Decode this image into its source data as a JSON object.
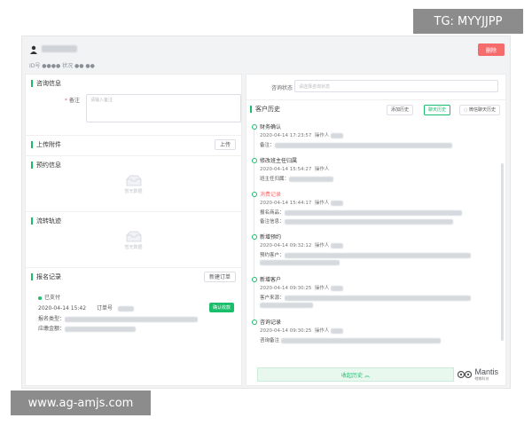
{
  "overlay_top": "TG: MYYJJPP",
  "overlay_bottom": "www.ag-amjs.com",
  "top": {
    "meta": "ID号 ●●●● 状况 ●● ●●",
    "action_button": "删除"
  },
  "left": {
    "consult_title": "咨询信息",
    "remark_label": "备注",
    "remark_placeholder": "请输入备注",
    "upload_title": "上传附件",
    "upload_button": "上传",
    "appointment_title": "预约信息",
    "empty_text": "暂无数据",
    "trail_title": "流转轨迹",
    "signup_title": "报名记录",
    "new_order_button": "新建订单",
    "order": {
      "status": "已支付",
      "time": "2020-04-14 15:42",
      "order_no_label": "订单号",
      "tag": "确认收款",
      "type_label": "报名类型：",
      "amount_label": "应缴金额："
    }
  },
  "right": {
    "search_label": "咨询状态",
    "search_placeholder": "请选择咨询状态",
    "history_title": "客户历史",
    "btn_follow": "添加历史",
    "btn_chat": "聊天历史",
    "btn_wechat": "微信聊天历史",
    "items": [
      {
        "title": "财务确认",
        "time": "2020-04-14 17:23:57",
        "op": "操作人",
        "detail_label": "备注："
      },
      {
        "title": "修改班主任归属",
        "time": "2020-04-14 15:54:27",
        "op": "操作人",
        "detail_label": "班主任归属："
      },
      {
        "title": "消费记录",
        "time": "2020-04-14 15:44:17",
        "op": "操作人",
        "detail_label": "报名商品：",
        "detail_label2": "备注信息："
      },
      {
        "title": "新增预约",
        "time": "2020-04-14 09:32:12",
        "op": "操作人",
        "detail_label": "预约客户："
      },
      {
        "title": "新增客户",
        "time": "2020-04-14 09:30:25",
        "op": "操作人",
        "detail_label": "客户来源："
      },
      {
        "title": "咨询记录",
        "time": "2020-04-14 09:30:25",
        "op": "操作人",
        "detail_label": "咨询备注"
      }
    ],
    "collapse_label": "收起历史 ︽",
    "brand": "Mantis",
    "brand_sub": "螳螂科技"
  },
  "colors": {
    "accent": "#19be6b",
    "danger": "#f56c6c"
  }
}
